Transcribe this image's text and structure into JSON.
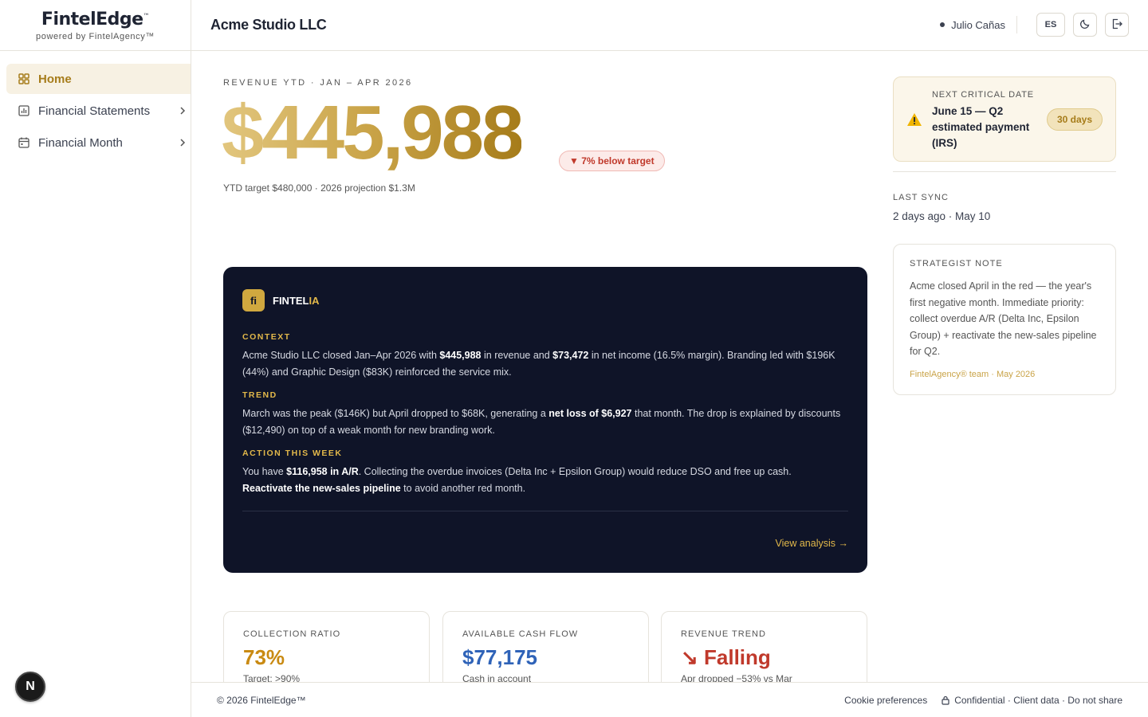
{
  "brand": {
    "name": "FintelEdge",
    "tm": "™",
    "sub": "powered by FintelAgency™"
  },
  "sidebar": {
    "items": [
      {
        "label": "Home",
        "icon": "grid-icon",
        "active": true
      },
      {
        "label": "Financial Statements",
        "icon": "bar-chart-icon"
      },
      {
        "label": "Financial Month",
        "icon": "calendar-icon"
      }
    ],
    "badge": "N"
  },
  "header": {
    "company": "Acme Studio LLC",
    "user": "Julio Cañas",
    "lang_button": "ES"
  },
  "revenue": {
    "label": "REVENUE YTD · JAN – APR 2026",
    "value": "$445,988",
    "badge": "▼ 7% below target",
    "sub": "YTD target $480,000 · 2026 projection $1.3M"
  },
  "ai": {
    "logo": "fi",
    "title_a": "FINTEL",
    "title_b": "IA",
    "context_title": "CONTEXT",
    "context": {
      "p1": "Acme Studio LLC closed Jan–Apr 2026 with ",
      "b1": "$445,988",
      "p2": " in revenue and ",
      "b2": "$73,472",
      "p3": " in net income (16.5% margin). Branding led with $196K (44%) and Graphic Design ($83K) reinforced the service mix."
    },
    "trend_title": "TREND",
    "trend": {
      "p1": "March was the peak ($146K) but April dropped to $68K, generating a ",
      "b1": "net loss of $6,927",
      "p2": " that month. The drop is explained by discounts ($12,490) on top of a weak month for new branding work."
    },
    "action_title": "ACTION THIS WEEK",
    "action": {
      "p1": "You have ",
      "b1": "$116,958 in A/R",
      "p2": ". Collecting the overdue invoices (Delta Inc + Epsilon Group) would reduce DSO and free up cash.",
      "b2": "Reactivate the new-sales pipeline",
      "p3": " to avoid another red month."
    },
    "link": "View analysis →"
  },
  "metrics": [
    {
      "label": "COLLECTION RATIO",
      "value": "73%",
      "sub": "Target: >90%",
      "color": "#c98a12"
    },
    {
      "label": "AVAILABLE CASH FLOW",
      "value": "$77,175",
      "sub": "Cash in account",
      "color": "#2f63b8"
    },
    {
      "label": "REVENUE TREND",
      "value": "↘ Falling",
      "sub": "Apr dropped −53% vs Mar",
      "color": "#c0392b"
    }
  ],
  "critical": {
    "label": "NEXT CRITICAL DATE",
    "text": "June 15 — Q2 estimated payment (IRS)",
    "badge": "30 days"
  },
  "sync": {
    "label": "LAST SYNC",
    "value": "2 days ago · May 10"
  },
  "note": {
    "label": "STRATEGIST NOTE",
    "text": "Acme closed April in the red — the year's first negative month. Immediate priority: collect overdue A/R (Delta Inc, Epsilon Group) + reactivate the new-sales pipeline for Q2.",
    "signature": "FintelAgency® team · May 2026"
  },
  "footer": {
    "copyright": "© 2026 FintelEdge™",
    "cookie": "Cookie preferences",
    "confidential": "Confidential · Client data · Do not share"
  }
}
